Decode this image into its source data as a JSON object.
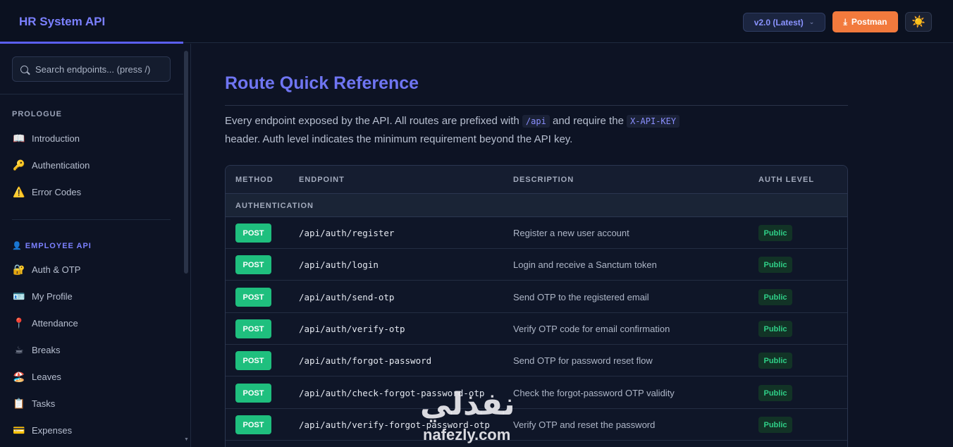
{
  "header": {
    "brand": "HR System API",
    "version_label": "v2.0 (Latest)",
    "postman_label": "Postman",
    "theme_icon": "☀️"
  },
  "sidebar": {
    "search_placeholder": "Search endpoints... (press /)",
    "sections": [
      {
        "label": "PROLOGUE",
        "items": [
          {
            "icon": "📖",
            "label": "Introduction"
          },
          {
            "icon": "🔑",
            "label": "Authentication"
          },
          {
            "icon": "⚠️",
            "label": "Error Codes"
          }
        ]
      },
      {
        "label": "👤 EMPLOYEE API",
        "items": [
          {
            "icon": "🔐",
            "label": "Auth & OTP"
          },
          {
            "icon": "🪪",
            "label": "My Profile"
          },
          {
            "icon": "📍",
            "label": "Attendance"
          },
          {
            "icon": "☕",
            "label": "Breaks"
          },
          {
            "icon": "🏖️",
            "label": "Leaves"
          },
          {
            "icon": "📋",
            "label": "Tasks"
          },
          {
            "icon": "💳",
            "label": "Expenses"
          }
        ]
      }
    ]
  },
  "main": {
    "title": "Route Quick Reference",
    "intro_part1": "Every endpoint exposed by the API. All routes are prefixed with",
    "intro_code1": "/api",
    "intro_part2": "and require the",
    "intro_code2": "X-API-KEY",
    "intro_part3": "header. Auth level indicates the minimum requirement beyond the API key.",
    "table": {
      "headers": [
        "METHOD",
        "ENDPOINT",
        "DESCRIPTION",
        "AUTH LEVEL"
      ],
      "group": "AUTHENTICATION",
      "rows": [
        {
          "method": "POST",
          "endpoint": "/api/auth/register",
          "description": "Register a new user account",
          "auth": "Public"
        },
        {
          "method": "POST",
          "endpoint": "/api/auth/login",
          "description": "Login and receive a Sanctum token",
          "auth": "Public"
        },
        {
          "method": "POST",
          "endpoint": "/api/auth/send-otp",
          "description": "Send OTP to the registered email",
          "auth": "Public"
        },
        {
          "method": "POST",
          "endpoint": "/api/auth/verify-otp",
          "description": "Verify OTP code for email confirmation",
          "auth": "Public"
        },
        {
          "method": "POST",
          "endpoint": "/api/auth/forgot-password",
          "description": "Send OTP for password reset flow",
          "auth": "Public"
        },
        {
          "method": "POST",
          "endpoint": "/api/auth/check-forgot-password-otp",
          "description": "Check the forgot-password OTP validity",
          "auth": "Public"
        },
        {
          "method": "POST",
          "endpoint": "/api/auth/verify-forgot-password-otp",
          "description": "Verify OTP and reset the password",
          "auth": "Public"
        }
      ]
    }
  },
  "watermark": {
    "arabic": "نفذلي",
    "latin": "nafezly.com"
  },
  "colors": {
    "accent": "#6f75f2",
    "post_method": "#1fbf7e",
    "postman": "#f27a3d",
    "public_badge": "#2fcf87"
  }
}
